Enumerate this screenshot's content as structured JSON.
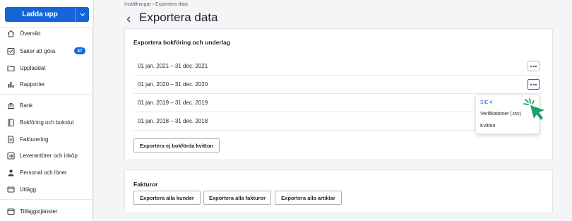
{
  "sidebar": {
    "upload_label": "Ladda upp",
    "items": [
      {
        "label": "Översikt",
        "icon": "home-icon"
      },
      {
        "label": "Saker att göra",
        "icon": "checklist-icon",
        "badge": "47"
      },
      {
        "label": "Uppladdat",
        "icon": "folder-icon"
      },
      {
        "label": "Rapporter",
        "icon": "bar-chart-icon"
      },
      {
        "label": "Bank",
        "icon": "bank-icon"
      },
      {
        "label": "Bokföring och bokslut",
        "icon": "ledger-icon"
      },
      {
        "label": "Fakturering",
        "icon": "invoice-icon"
      },
      {
        "label": "Leverantörer och inköp",
        "icon": "supplier-icon"
      },
      {
        "label": "Personal och löner",
        "icon": "person-icon"
      },
      {
        "label": "Utlägg",
        "icon": "expense-icon"
      },
      {
        "label": "Tilläggstjänster",
        "icon": "addon-icon"
      }
    ]
  },
  "breadcrumb": "Inställningar › Exportera data",
  "page_title": "Exportera data",
  "bookkeeping": {
    "title": "Exportera bokföring och underlag",
    "periods": [
      "01 jan. 2021 – 31 dec. 2021",
      "01 jan. 2020 – 31 dec. 2020",
      "01 jan. 2019 – 31 dec. 2019",
      "01 jan. 2018 – 31 dec. 2018"
    ],
    "export_receipts_label": "Exportera ej bokförda kvitton",
    "menu": [
      "SIE 4",
      "Verifikationer (.tsv)",
      "Kvitton"
    ]
  },
  "invoices": {
    "title": "Fakturor",
    "buttons": [
      "Exportera alla kunder",
      "Exportera alla fakturor",
      "Exportera alla artiklar"
    ]
  },
  "colors": {
    "accent": "#1565d8",
    "cursor": "#1aa36a"
  }
}
